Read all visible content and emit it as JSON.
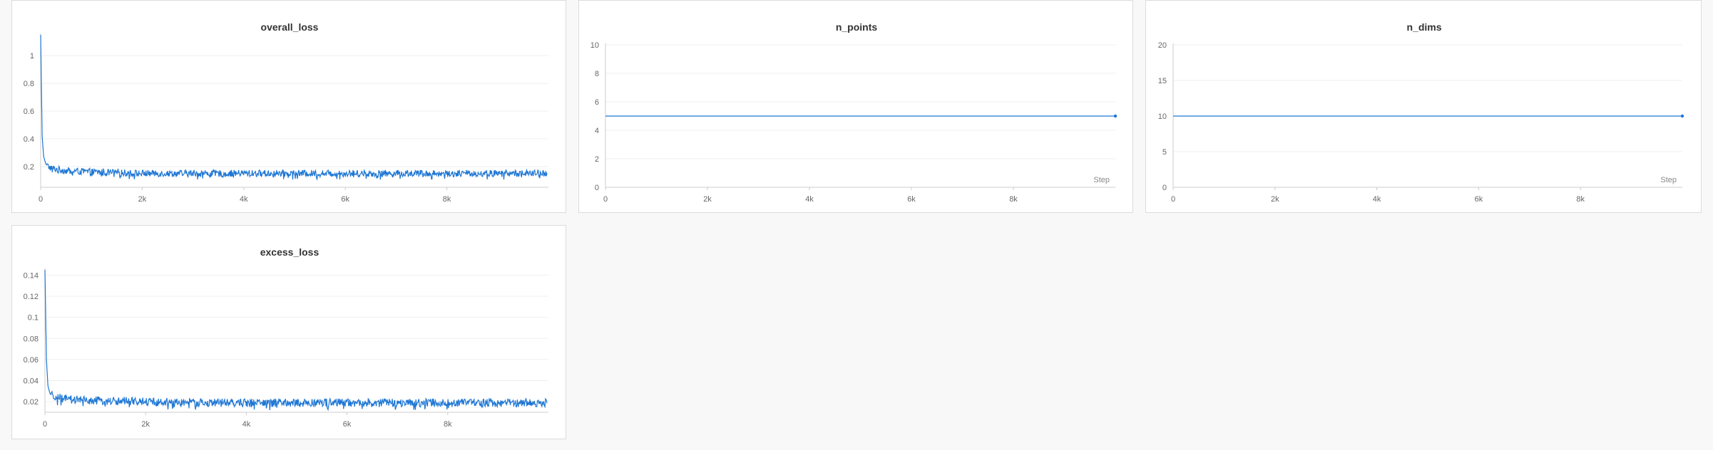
{
  "chart_data": [
    {
      "type": "line",
      "title": "overall_loss",
      "xlabel": "",
      "ylabel": "",
      "x_ticks": [
        "0",
        "2k",
        "4k",
        "6k",
        "8k"
      ],
      "y_ticks": [
        "0.2",
        "0.4",
        "0.6",
        "0.8",
        "1"
      ],
      "xlim": [
        0,
        10000
      ],
      "ylim": [
        0.05,
        1.15
      ],
      "grid": true,
      "series": [
        {
          "color": "#1f77d4",
          "x": [
            0,
            30,
            60,
            100,
            150,
            200,
            300,
            500,
            1000,
            2000,
            3000,
            4000,
            5000,
            6000,
            7000,
            8000,
            9000,
            9970
          ],
          "y": [
            1.15,
            0.42,
            0.27,
            0.22,
            0.2,
            0.19,
            0.18,
            0.17,
            0.16,
            0.15,
            0.15,
            0.15,
            0.15,
            0.15,
            0.15,
            0.15,
            0.15,
            0.15
          ],
          "noise": 0.025
        }
      ]
    },
    {
      "type": "line",
      "title": "n_points",
      "xlabel": "Step",
      "ylabel": "",
      "x_ticks": [
        "0",
        "2k",
        "4k",
        "6k",
        "8k"
      ],
      "y_ticks": [
        "0",
        "2",
        "4",
        "6",
        "8",
        "10"
      ],
      "xlim": [
        0,
        10000
      ],
      "ylim": [
        0,
        10
      ],
      "grid": true,
      "series": [
        {
          "color": "#1f77d4",
          "x": [
            0,
            10000
          ],
          "y": [
            5,
            5
          ],
          "noise": 0
        }
      ]
    },
    {
      "type": "line",
      "title": "n_dims",
      "xlabel": "Step",
      "ylabel": "",
      "x_ticks": [
        "0",
        "2k",
        "4k",
        "6k",
        "8k"
      ],
      "y_ticks": [
        "0",
        "5",
        "10",
        "15",
        "20"
      ],
      "xlim": [
        0,
        10000
      ],
      "ylim": [
        0,
        20
      ],
      "grid": true,
      "series": [
        {
          "color": "#1f77d4",
          "x": [
            0,
            10000
          ],
          "y": [
            10,
            10
          ],
          "noise": 0
        }
      ]
    },
    {
      "type": "line",
      "title": "excess_loss",
      "xlabel": "",
      "ylabel": "",
      "x_ticks": [
        "0",
        "2k",
        "4k",
        "6k",
        "8k"
      ],
      "y_ticks": [
        "0.02",
        "0.04",
        "0.06",
        "0.08",
        "0.1",
        "0.12",
        "0.14"
      ],
      "xlim": [
        0,
        10000
      ],
      "ylim": [
        0.01,
        0.145
      ],
      "grid": true,
      "series": [
        {
          "color": "#1f77d4",
          "x": [
            0,
            30,
            60,
            100,
            150,
            200,
            300,
            500,
            1000,
            2000,
            3000,
            4000,
            5000,
            6000,
            7000,
            8000,
            9000,
            9970
          ],
          "y": [
            0.145,
            0.06,
            0.035,
            0.028,
            0.025,
            0.024,
            0.023,
            0.022,
            0.021,
            0.02,
            0.019,
            0.019,
            0.019,
            0.019,
            0.019,
            0.019,
            0.019,
            0.019
          ],
          "noise": 0.004
        }
      ]
    }
  ]
}
